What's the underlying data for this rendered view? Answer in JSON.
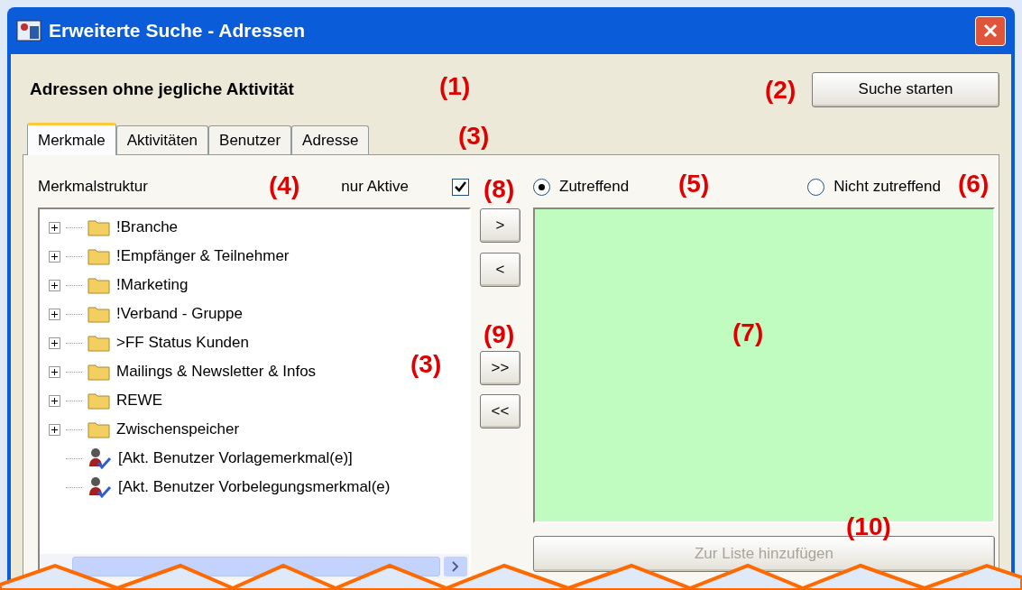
{
  "window": {
    "title": "Erweiterte Suche - Adressen"
  },
  "heading": "Adressen ohne jegliche Aktivität",
  "search_button": {
    "label": "Suche starten"
  },
  "tabs": [
    {
      "label": "Merkmale",
      "selected": true
    },
    {
      "label": "Aktivitäten",
      "selected": false
    },
    {
      "label": "Benutzer",
      "selected": false
    },
    {
      "label": "Adresse",
      "selected": false
    }
  ],
  "tree_label": "Merkmalstruktur",
  "only_active": {
    "label": "nur Aktive",
    "checked": true
  },
  "tree": [
    {
      "kind": "folder",
      "label": "!Branche"
    },
    {
      "kind": "folder",
      "label": "!Empfänger & Teilnehmer"
    },
    {
      "kind": "folder",
      "label": "!Marketing"
    },
    {
      "kind": "folder",
      "label": "!Verband - Gruppe"
    },
    {
      "kind": "folder",
      "label": ">FF Status Kunden"
    },
    {
      "kind": "folder",
      "label": "Mailings & Newsletter & Infos"
    },
    {
      "kind": "folder",
      "label": "REWE"
    },
    {
      "kind": "folder",
      "label": "Zwischenspeicher"
    },
    {
      "kind": "user",
      "label": "[Akt. Benutzer Vorlagemerkmal(e)]"
    },
    {
      "kind": "user",
      "label": "[Akt. Benutzer Vorbelegungsmerkmal(e)"
    }
  ],
  "move_buttons": [
    ">",
    "<",
    ">>",
    "<<"
  ],
  "match_options": [
    {
      "label": "Zutreffend",
      "selected": true
    },
    {
      "label": "Nicht zutreffend",
      "selected": false
    }
  ],
  "add_button": {
    "label": "Zur Liste hinzufügen",
    "disabled": true
  },
  "annotations": [
    "(1)",
    "(2)",
    "(3)",
    "(4)",
    "(8)",
    "(5)",
    "(6)",
    "(9)",
    "(3)",
    "(7)",
    "(10)"
  ]
}
